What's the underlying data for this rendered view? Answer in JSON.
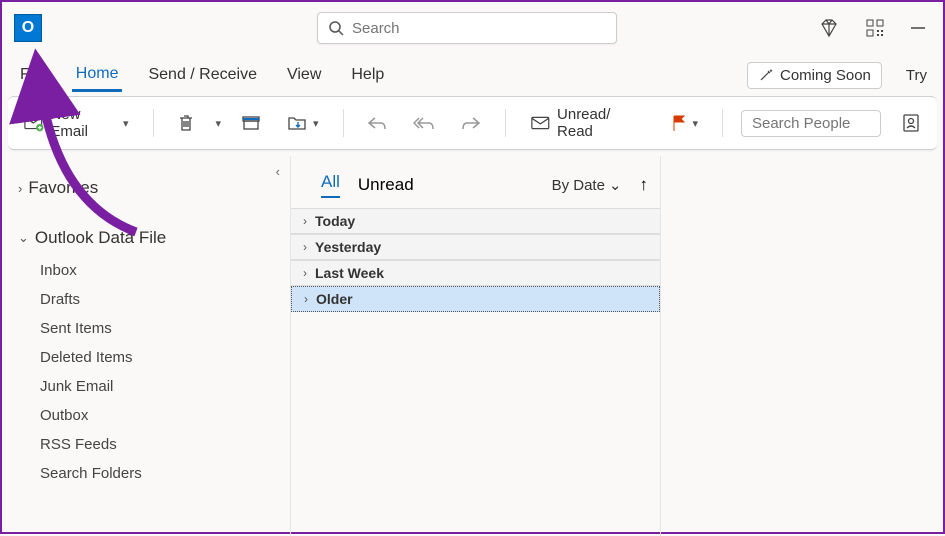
{
  "titlebar": {
    "logo_letter": "O",
    "search_placeholder": "Search"
  },
  "menubar": {
    "items": [
      "File",
      "Home",
      "Send / Receive",
      "View",
      "Help"
    ],
    "active_index": 1,
    "coming_soon": "Coming Soon",
    "try": "Try"
  },
  "ribbon": {
    "new_email": "New Email",
    "unread_read": "Unread/ Read",
    "search_people_placeholder": "Search People"
  },
  "sidebar": {
    "favorites": "Favorites",
    "datafile_label": "Outlook Data File",
    "folders": [
      "Inbox",
      "Drafts",
      "Sent Items",
      "Deleted Items",
      "Junk Email",
      "Outbox",
      "RSS Feeds",
      "Search Folders"
    ]
  },
  "listpane": {
    "tabs": [
      "All",
      "Unread"
    ],
    "active_tab": 0,
    "sort_label": "By Date",
    "groups": [
      "Today",
      "Yesterday",
      "Last Week",
      "Older"
    ],
    "selected_group": 3
  }
}
